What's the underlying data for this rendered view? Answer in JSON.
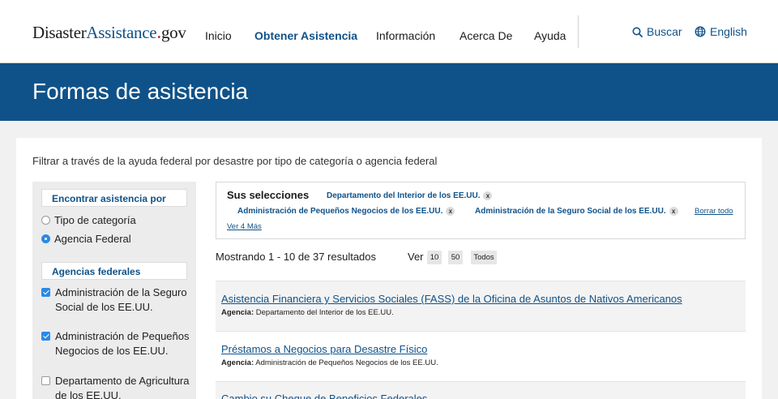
{
  "header": {
    "logo": {
      "part1": "Disaster",
      "part2": "Assistance",
      "part3": ".gov"
    },
    "nav": [
      {
        "label": "Inicio",
        "active": false
      },
      {
        "label": "Obtener Asistencia",
        "active": true
      },
      {
        "label": "Información",
        "active": false
      },
      {
        "label": "Acerca De",
        "active": false
      },
      {
        "label": "Ayuda",
        "active": false
      }
    ],
    "search_label": "Buscar",
    "language_label": "English"
  },
  "banner": {
    "title": "Formas de asistencia"
  },
  "intro": "Filtrar a través de la ayuda federal por desastre por tipo de categoría o agencia federal",
  "sidebar": {
    "find_heading": "Encontrar asistencia por",
    "options": [
      {
        "label": "Tipo de categoría",
        "selected": false
      },
      {
        "label": "Agencia Federal",
        "selected": true
      }
    ],
    "agencies_heading": "Agencias federales",
    "agencies": [
      {
        "label": "Administración de la Seguro Social de los EE.UU.",
        "checked": true
      },
      {
        "label": "Administración de Pequeños Negocios de los EE.UU.",
        "checked": true
      },
      {
        "label": "Departamento de Agricultura de los EE.UU.",
        "checked": false
      }
    ]
  },
  "selections": {
    "title": "Sus selecciones",
    "chips": [
      "Departamento del Interior de los EE.UU.",
      "Administración de Pequeños Negocios de los EE.UU.",
      "Administración de la Seguro Social de los EE.UU."
    ],
    "remove_symbol": "x",
    "clear_all": "Borrar todo",
    "more": "Ver 4 Más"
  },
  "results": {
    "count_text": "Mostrando 1 - 10 de 37 resultados",
    "view_label": "Ver",
    "page_sizes": [
      "10",
      "50",
      "Todos"
    ],
    "agency_label": "Agencia:",
    "items": [
      {
        "title": "Asistencia Financiera y Servicios Sociales (FASS) de la Oficina de Asuntos de Nativos Americanos",
        "agency": "Departamento del Interior de los EE.UU."
      },
      {
        "title": "Préstamos a Negocios para Desastre Físico",
        "agency": "Administración de Pequeños Negocios de los EE.UU."
      },
      {
        "title": "Cambio su Cheque de Beneficios Federales",
        "agency": ""
      }
    ]
  },
  "colors": {
    "brand_blue": "#0f5289",
    "logo_dot": "#c1272d",
    "checkbox_blue": "#2b8ae6"
  },
  "icons": {
    "search": "search-icon",
    "language": "globe-icon"
  }
}
